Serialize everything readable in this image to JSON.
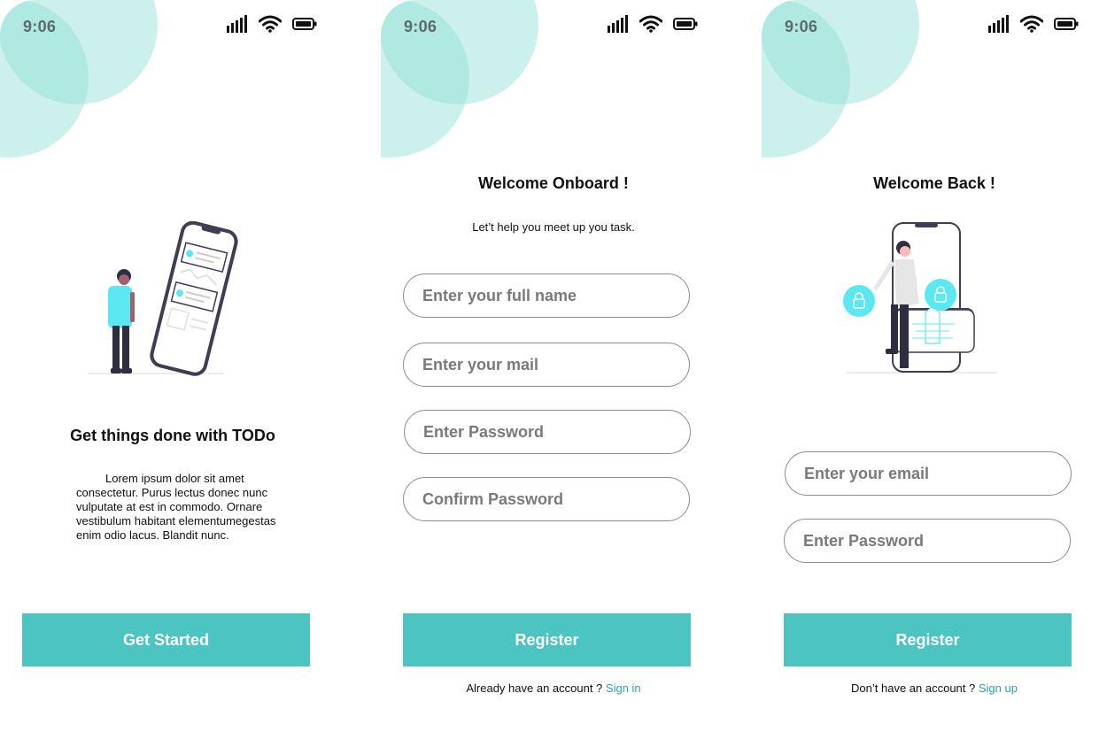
{
  "theme": {
    "accent": "#4cc4c1",
    "blob": "#8fe0d4",
    "link": "#2aa5a0",
    "dark": "#3f3d56"
  },
  "status_bar": {
    "time": "9:06",
    "icons": [
      "cellular-signal-icon",
      "wifi-icon",
      "battery-icon"
    ]
  },
  "screens": [
    {
      "id": "onboarding",
      "title": "Get things done with TODo",
      "body": "Lorem ipsum dolor sit amet consectetur. Purus lectus donec nunc vulputate at est in commodo. Ornare vestibulum habitant elementumegestas enim odio lacus. Blandit nunc.",
      "button_label": "Get Started"
    },
    {
      "id": "register",
      "title": "Welcome Onboard !",
      "subtitle": "Let’t  help you meet up you task.",
      "fields": [
        {
          "placeholder": "Enter your full name"
        },
        {
          "placeholder": "Enter your mail"
        },
        {
          "placeholder": "Enter Password"
        },
        {
          "placeholder": "Confirm Password"
        }
      ],
      "button_label": "Register",
      "footer_text": "Already have an account ? ",
      "footer_link": "Sign in"
    },
    {
      "id": "login",
      "title": "Welcome Back !",
      "fields": [
        {
          "placeholder": "Enter your email"
        },
        {
          "placeholder": "Enter Password"
        }
      ],
      "button_label": "Register",
      "footer_text": "Don’t have an account ?  ",
      "footer_link": "Sign up"
    }
  ]
}
